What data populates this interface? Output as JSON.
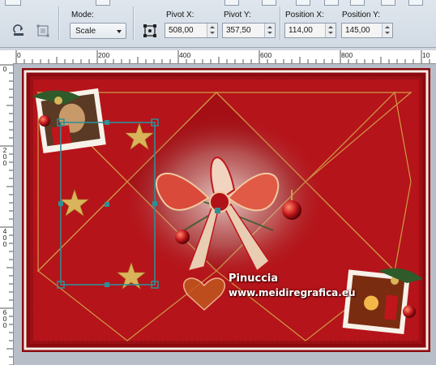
{
  "toolbar": {
    "mode_label": "Mode:",
    "mode_value": "Scale",
    "pivot_x_label": "Pivot X:",
    "pivot_x_value": "508,00",
    "pivot_y_label": "Pivot Y:",
    "pivot_y_value": "357,50",
    "position_x_label": "Position X:",
    "position_x_value": "114,00",
    "position_y_label": "Position Y:",
    "position_y_value": "145,00"
  },
  "ruler": {
    "horizontal": [
      "0",
      "200",
      "400",
      "600",
      "800",
      "10"
    ],
    "vertical": [
      "0",
      "200",
      "400",
      "600"
    ]
  },
  "artwork": {
    "watermark_line1": "Pinuccia",
    "watermark_line2": "www.meidiregrafica.eu"
  },
  "colors": {
    "deep_red": "#9c0d12",
    "gold": "#d4aa4a",
    "selection": "#2f8f95"
  }
}
